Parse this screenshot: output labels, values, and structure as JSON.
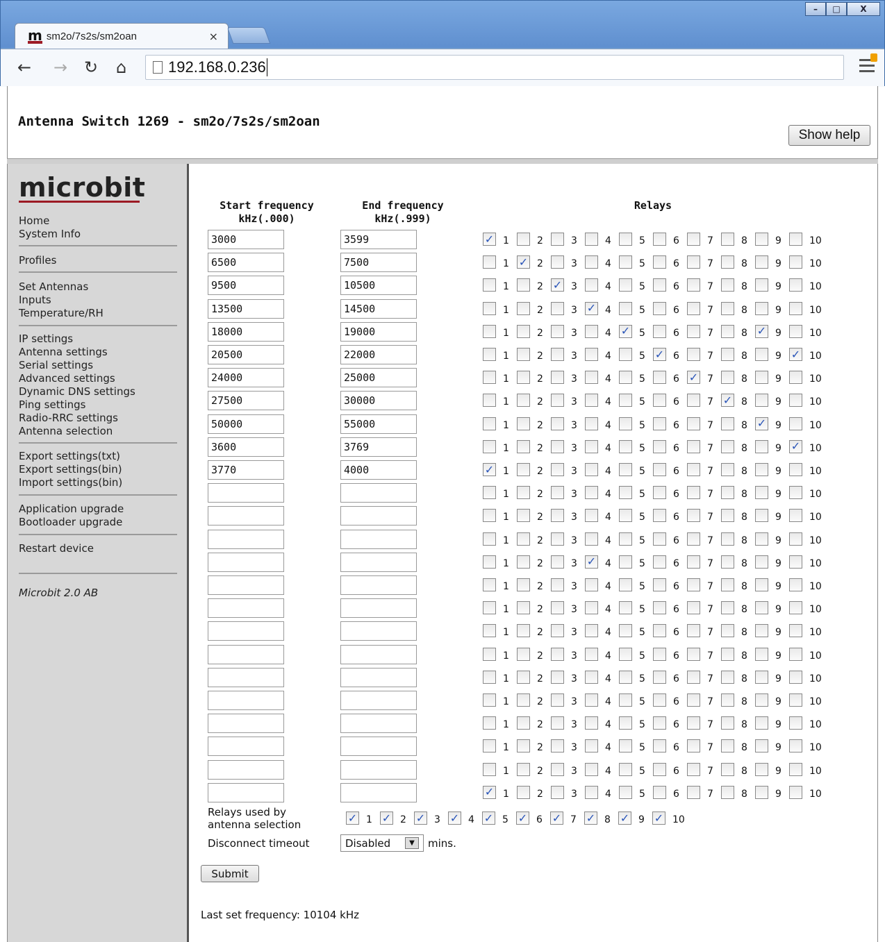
{
  "browser": {
    "tab_title": "sm2o/7s2s/sm2oan",
    "tab_logo": "m",
    "url": "192.168.0.236",
    "window_controls": [
      "minimize-icon",
      "maximize-icon",
      "close-icon"
    ]
  },
  "header": {
    "title": "Antenna Switch 1269 - sm2o/7s2s/sm2oan",
    "help_button": "Show help"
  },
  "sidebar": {
    "brand": "microbit",
    "groups": [
      [
        "Home",
        "System Info"
      ],
      [
        "Profiles"
      ],
      [
        "Set Antennas",
        "Inputs",
        "Temperature/RH"
      ],
      [
        "IP settings",
        "Antenna settings",
        "Serial settings",
        "Advanced settings",
        "Dynamic DNS settings",
        "Ping settings",
        "Radio-RRC settings",
        "Antenna selection"
      ],
      [
        "Export settings(txt)",
        "Export settings(bin)",
        "Import settings(bin)"
      ],
      [
        "Application upgrade",
        "Bootloader upgrade"
      ],
      [
        "Restart device"
      ]
    ],
    "footer": "Microbit 2.0 AB"
  },
  "table": {
    "start_header": [
      "Start frequency",
      "kHz(.000)"
    ],
    "end_header": [
      "End frequency",
      "kHz(.999)"
    ],
    "relays_header": "Relays",
    "relay_numbers": [
      "1",
      "2",
      "3",
      "4",
      "5",
      "6",
      "7",
      "8",
      "9",
      "10"
    ],
    "rows": [
      {
        "start": "3000",
        "end": "3599",
        "relays": [
          1
        ]
      },
      {
        "start": "6500",
        "end": "7500",
        "relays": [
          2
        ]
      },
      {
        "start": "9500",
        "end": "10500",
        "relays": [
          3
        ]
      },
      {
        "start": "13500",
        "end": "14500",
        "relays": [
          4
        ]
      },
      {
        "start": "18000",
        "end": "19000",
        "relays": [
          5,
          9
        ]
      },
      {
        "start": "20500",
        "end": "22000",
        "relays": [
          6,
          10
        ]
      },
      {
        "start": "24000",
        "end": "25000",
        "relays": [
          7
        ]
      },
      {
        "start": "27500",
        "end": "30000",
        "relays": [
          8
        ]
      },
      {
        "start": "50000",
        "end": "55000",
        "relays": [
          9
        ]
      },
      {
        "start": "3600",
        "end": "3769",
        "relays": [
          10
        ]
      },
      {
        "start": "3770",
        "end": "4000",
        "relays": [
          1
        ]
      },
      {
        "start": "",
        "end": "",
        "relays": []
      },
      {
        "start": "",
        "end": "",
        "relays": []
      },
      {
        "start": "",
        "end": "",
        "relays": []
      },
      {
        "start": "",
        "end": "",
        "relays": [
          4
        ]
      },
      {
        "start": "",
        "end": "",
        "relays": []
      },
      {
        "start": "",
        "end": "",
        "relays": []
      },
      {
        "start": "",
        "end": "",
        "relays": []
      },
      {
        "start": "",
        "end": "",
        "relays": []
      },
      {
        "start": "",
        "end": "",
        "relays": []
      },
      {
        "start": "",
        "end": "",
        "relays": []
      },
      {
        "start": "",
        "end": "",
        "relays": []
      },
      {
        "start": "",
        "end": "",
        "relays": []
      },
      {
        "start": "",
        "end": "",
        "relays": []
      },
      {
        "start": "",
        "end": "",
        "relays": [
          1
        ]
      }
    ]
  },
  "antenna_selection": {
    "label": "Relays used by antenna selection",
    "relays": [
      1,
      2,
      3,
      4,
      5,
      6,
      7,
      8,
      9,
      10
    ]
  },
  "disconnect": {
    "label": "Disconnect timeout",
    "value": "Disabled",
    "unit": "mins."
  },
  "submit_label": "Submit",
  "status": "Last set frequency: 10104 kHz"
}
